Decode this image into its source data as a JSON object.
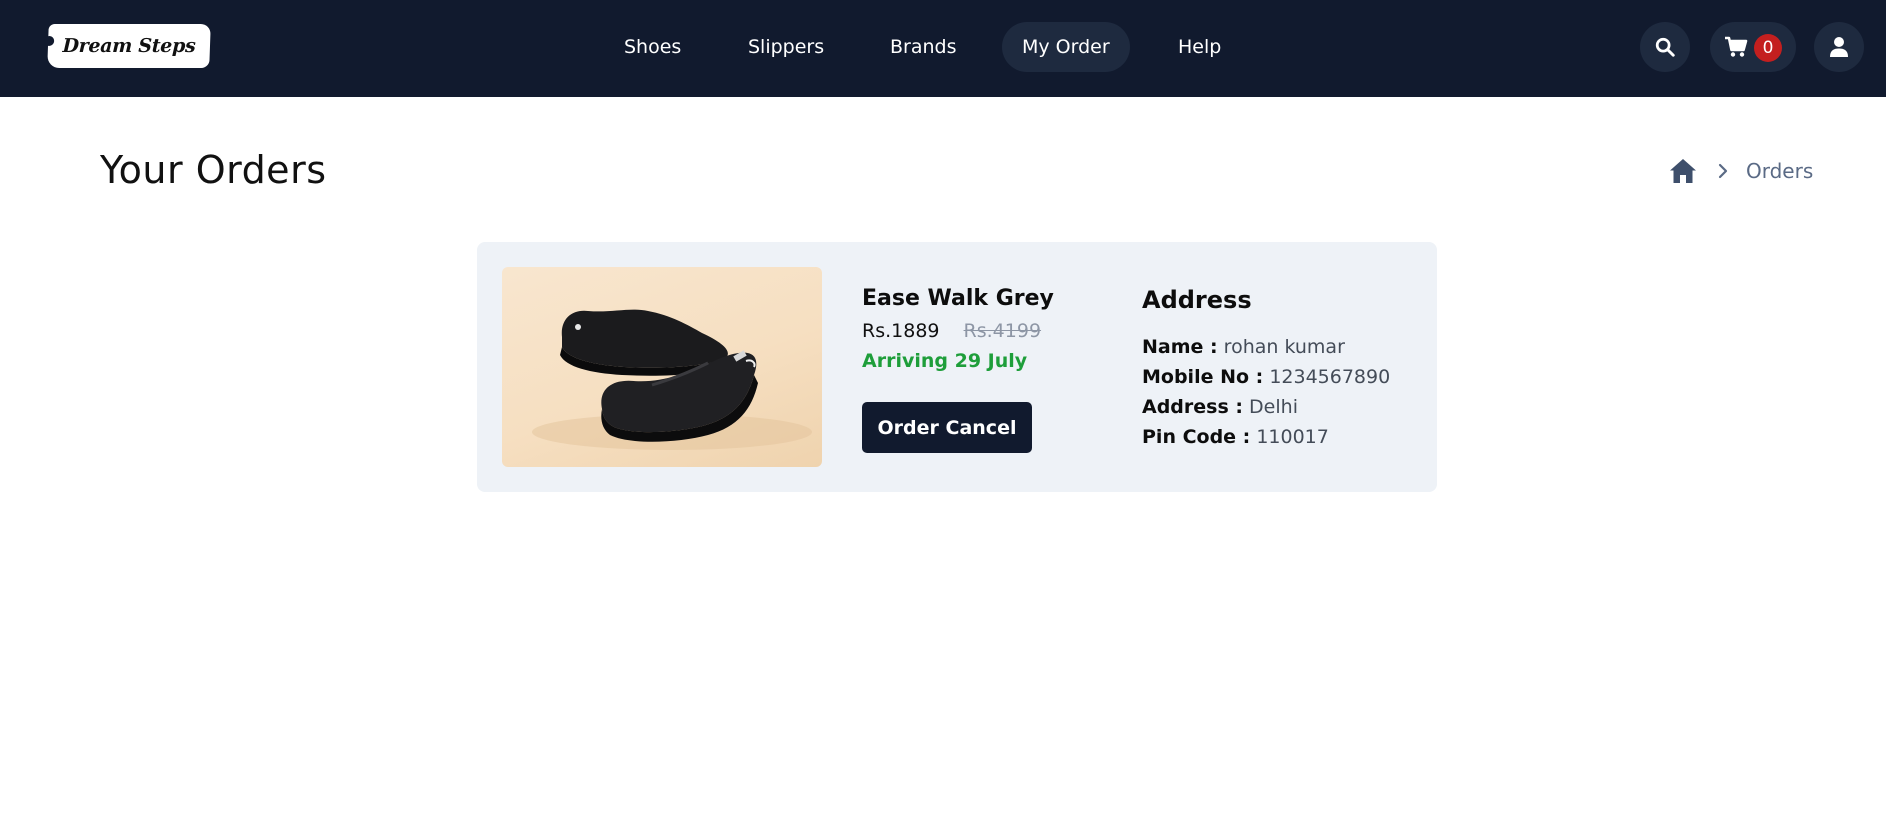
{
  "header": {
    "logo_text": "Dream Steps",
    "nav": [
      {
        "label": "Shoes",
        "active": false
      },
      {
        "label": "Slippers",
        "active": false
      },
      {
        "label": "Brands",
        "active": false
      },
      {
        "label": "My Order",
        "active": true
      },
      {
        "label": "Help",
        "active": false
      }
    ],
    "cart_count": "0",
    "icons": [
      "search-icon",
      "cart-icon",
      "user-icon"
    ]
  },
  "page": {
    "title": "Your Orders",
    "breadcrumb": {
      "home_icon": "home-icon",
      "separator_icon": "chevron-right-icon",
      "current": "Orders"
    }
  },
  "order": {
    "product_name": "Ease Walk Grey",
    "price": "Rs.1889",
    "original_price": "Rs.4199",
    "arrival": "Arriving 29 July",
    "cancel_label": "Order Cancel",
    "address": {
      "heading": "Address",
      "name_label": "Name :",
      "name": "rohan kumar",
      "mobile_label": "Mobile No :",
      "mobile": "1234567890",
      "address_label": "Address :",
      "address": "Delhi",
      "pincode_label": "Pin Code :",
      "pincode": "110017"
    }
  },
  "colors": {
    "navbar_bg": "#111a2e",
    "pill_bg": "#1e2a3f",
    "badge_bg": "#c41f1f",
    "card_bg": "#eef2f7",
    "arrival_green": "#1e9e3a",
    "breadcrumb_gray": "#5a6a85"
  }
}
